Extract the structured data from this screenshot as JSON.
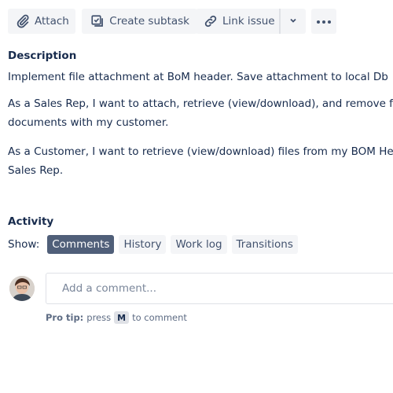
{
  "toolbar": {
    "attach_label": "Attach",
    "create_subtask_label": "Create subtask",
    "link_issue_label": "Link issue",
    "icons": {
      "attach": "paperclip-icon",
      "subtask": "subtask-icon",
      "link": "link-icon",
      "dropdown": "chevron-down-icon",
      "more": "more-icon"
    }
  },
  "description": {
    "heading": "Description",
    "paragraphs": [
      "Implement file attachment at BoM header.  Save attachment to local Db",
      "As a Sales Rep, I want to attach, retrieve (view/download), and remove files to/from",
      "documents with my customer.",
      "As a Customer, I want to retrieve (view/download) files from my BOM Header so",
      "Sales Rep."
    ]
  },
  "activity": {
    "heading": "Activity",
    "show_label": "Show:",
    "filters": [
      {
        "label": "Comments",
        "active": true
      },
      {
        "label": "History",
        "active": false
      },
      {
        "label": "Work log",
        "active": false
      },
      {
        "label": "Transitions",
        "active": false
      }
    ]
  },
  "comment": {
    "placeholder": "Add a comment...",
    "value": "",
    "pro_tip_label": "Pro tip:",
    "pro_tip_press": "press",
    "pro_tip_key": "M",
    "pro_tip_suffix": "to comment"
  },
  "colors": {
    "button_bg": "#f4f5f7",
    "active_filter_bg": "#505f79",
    "text": "#172b4d",
    "subtle_text": "#42526e"
  }
}
